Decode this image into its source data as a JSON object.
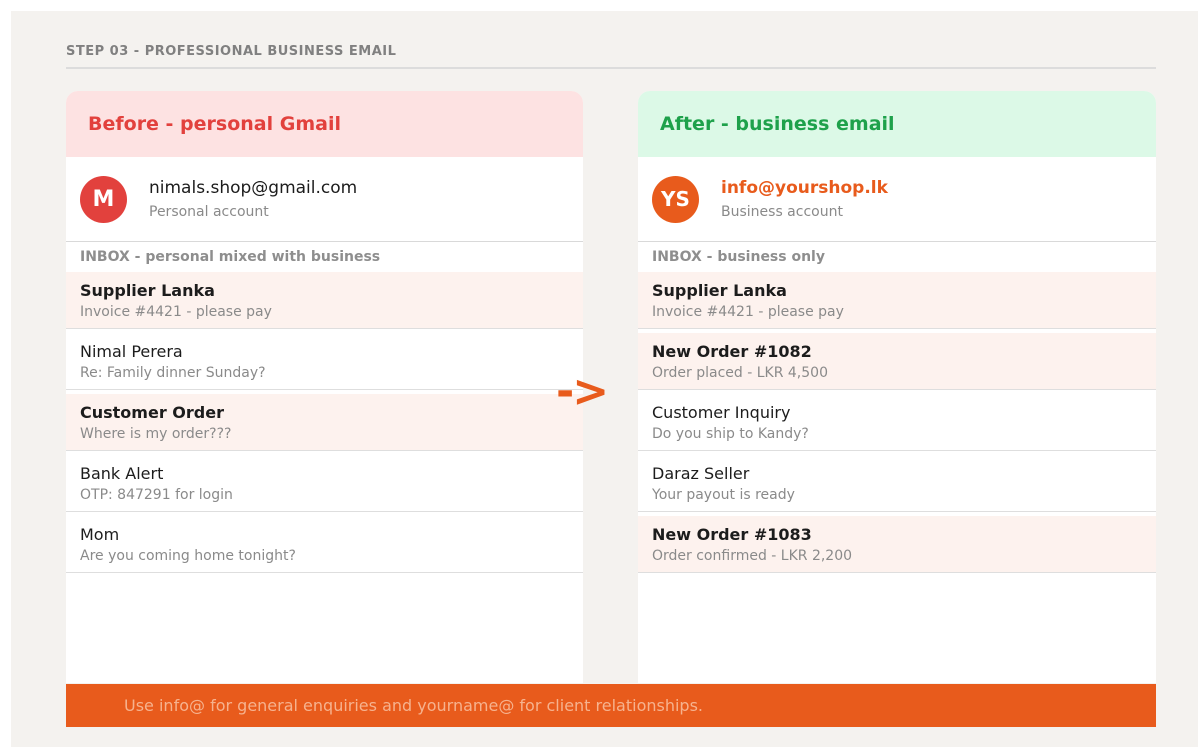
{
  "step_title": "STEP 03 - PROFESSIONAL BUSINESS EMAIL",
  "arrow": "->",
  "before": {
    "header": "Before - personal Gmail",
    "avatar": "M",
    "email": "nimals.shop@gmail.com",
    "account_type": "Personal account",
    "inbox_label": "INBOX - personal mixed with business",
    "messages": [
      {
        "from": "Supplier Lanka",
        "subject": "Invoice #4421 - please pay",
        "highlight": true
      },
      {
        "from": "Nimal Perera",
        "subject": "Re: Family dinner Sunday?",
        "highlight": false
      },
      {
        "from": "Customer Order",
        "subject": "Where is my order???",
        "highlight": true
      },
      {
        "from": "Bank Alert",
        "subject": "OTP: 847291 for login",
        "highlight": false
      },
      {
        "from": "Mom",
        "subject": "Are you coming home tonight?",
        "highlight": false
      }
    ]
  },
  "after": {
    "header": "After - business email",
    "avatar": "YS",
    "email": "info@yourshop.lk",
    "account_type": "Business account",
    "inbox_label": "INBOX - business only",
    "messages": [
      {
        "from": "Supplier Lanka",
        "subject": "Invoice #4421 - please pay",
        "highlight": true
      },
      {
        "from": "New Order #1082",
        "subject": "Order placed - LKR 4,500",
        "highlight": true
      },
      {
        "from": "Customer Inquiry",
        "subject": "Do you ship to Kandy?",
        "highlight": false
      },
      {
        "from": "Daraz Seller",
        "subject": "Your payout is ready",
        "highlight": false
      },
      {
        "from": "New Order #1083",
        "subject": "Order confirmed - LKR 2,200",
        "highlight": true
      }
    ]
  },
  "banner": "Use info@ for general enquiries and yourname@ for client relationships.",
  "colors": {
    "accent": "#e85b1c",
    "before_red": "#e2413d",
    "after_green": "#1ea14b",
    "highlight_row": "#fdf2ee"
  }
}
